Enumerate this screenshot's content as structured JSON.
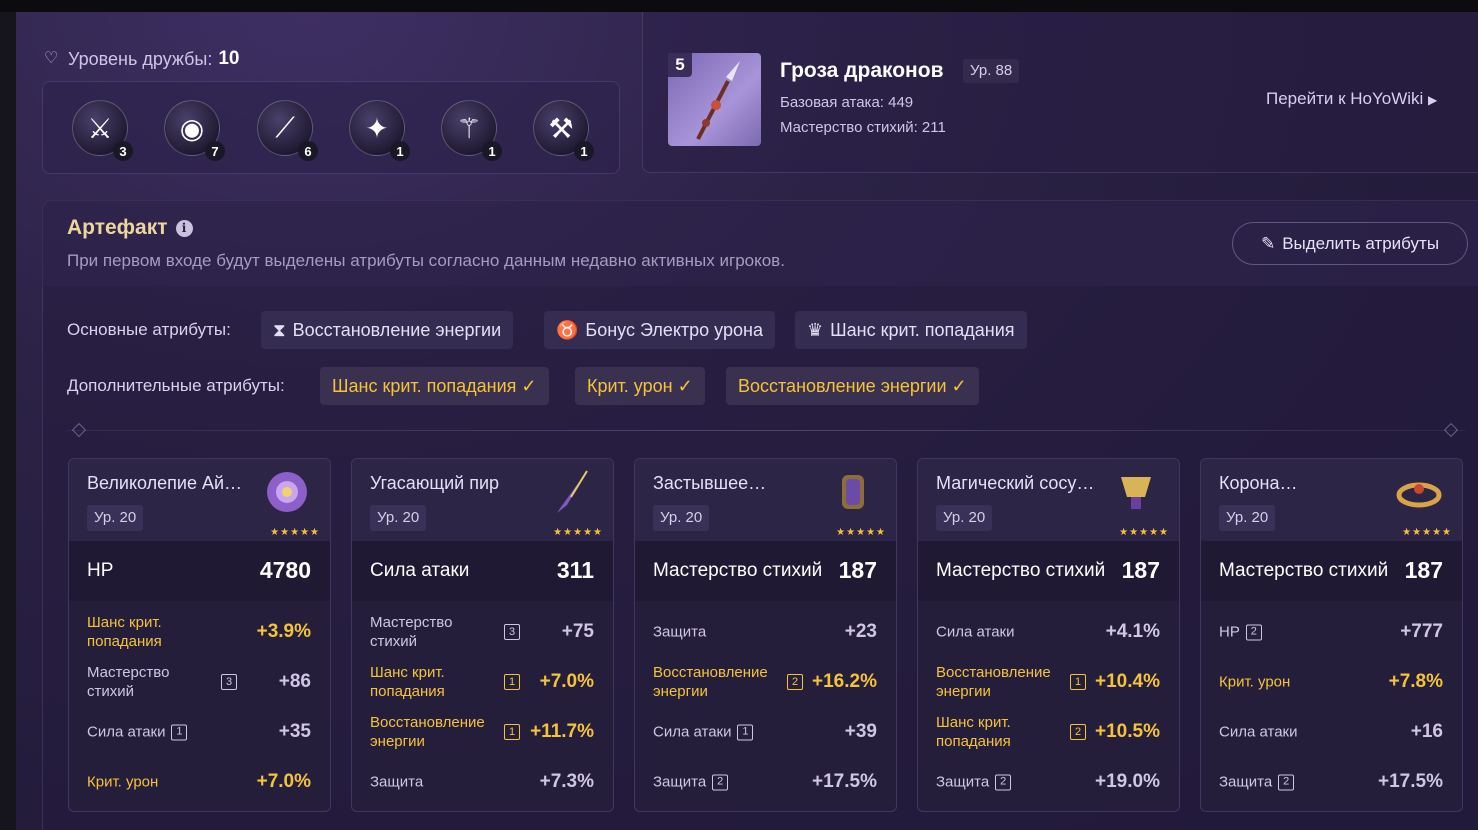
{
  "friendship": {
    "label": "Уровень дружбы:",
    "value": "10"
  },
  "constellations": [
    {
      "icon": "crossed-swords-icon",
      "count": "3"
    },
    {
      "icon": "eye-icon",
      "count": "7"
    },
    {
      "icon": "slash-icon",
      "count": "6"
    },
    {
      "icon": "sparkles-icon",
      "count": "1"
    },
    {
      "icon": "blade-icon",
      "count": "1"
    },
    {
      "icon": "triple-blade-icon",
      "count": "1"
    }
  ],
  "weapon": {
    "rank": "5",
    "name": "Гроза драконов",
    "level": "Ур. 88",
    "base_atk": "Базовая атака: 449",
    "substat": "Мастерство стихий: 211",
    "wiki_link": "Перейти к HoYoWiki"
  },
  "artifact": {
    "title": "Артефакт",
    "subtitle": "При первом входе будут выделены атрибуты согласно данным недавно активных игроков.",
    "highlight_button": "Выделить атрибуты",
    "main_label": "Основные атрибуты:",
    "main_attrs": [
      {
        "icon": "hourglass-icon",
        "label": "Восстановление энергии"
      },
      {
        "icon": "goblet-icon",
        "label": "Бонус Электро урона"
      },
      {
        "icon": "crown-icon",
        "label": "Шанс крит. попадания"
      }
    ],
    "sub_label": "Дополнительные атрибуты:",
    "sub_attrs": [
      {
        "label": "Шанс крит. попадания ✓"
      },
      {
        "label": "Крит. урон ✓"
      },
      {
        "label": "Восстановление энергии ✓"
      }
    ],
    "stars": "★★★★★",
    "cards": [
      {
        "name": "Великолепие Ай…",
        "level": "Ур. 20",
        "main": "HP",
        "main_val": "4780",
        "subs": [
          {
            "name": "Шанс крит. попадания",
            "roll": "",
            "val": "+3.9%",
            "hl": true
          },
          {
            "name": "Мастерство стихий",
            "roll": "3",
            "val": "+86",
            "hl": false
          },
          {
            "name": "Сила атаки",
            "roll": "1",
            "val": "+35",
            "hl": false
          },
          {
            "name": "Крит. урон",
            "roll": "",
            "val": "+7.0%",
            "hl": true
          }
        ]
      },
      {
        "name": "Угасающий пир",
        "level": "Ур. 20",
        "main": "Сила атаки",
        "main_val": "311",
        "subs": [
          {
            "name": "Мастерство стихий",
            "roll": "3",
            "val": "+75",
            "hl": false
          },
          {
            "name": "Шанс крит. попадания",
            "roll": "1",
            "val": "+7.0%",
            "hl": true
          },
          {
            "name": "Восстановление энергии",
            "roll": "1",
            "val": "+11.7%",
            "hl": true
          },
          {
            "name": "Защита",
            "roll": "",
            "val": "+7.3%",
            "hl": false
          }
        ]
      },
      {
        "name": "Застывшее…",
        "level": "Ур. 20",
        "main": "Мастерство стихий",
        "main_val": "187",
        "subs": [
          {
            "name": "Защита",
            "roll": "",
            "val": "+23",
            "hl": false
          },
          {
            "name": "Восстановление энергии",
            "roll": "2",
            "val": "+16.2%",
            "hl": true
          },
          {
            "name": "Сила атаки",
            "roll": "1",
            "val": "+39",
            "hl": false
          },
          {
            "name": "Защита",
            "roll": "2",
            "val": "+17.5%",
            "hl": false
          }
        ]
      },
      {
        "name": "Магический сосу…",
        "level": "Ур. 20",
        "main": "Мастерство стихий",
        "main_val": "187",
        "subs": [
          {
            "name": "Сила атаки",
            "roll": "",
            "val": "+4.1%",
            "hl": false
          },
          {
            "name": "Восстановление энергии",
            "roll": "1",
            "val": "+10.4%",
            "hl": true
          },
          {
            "name": "Шанс крит. попадания",
            "roll": "2",
            "val": "+10.5%",
            "hl": true
          },
          {
            "name": "Защита",
            "roll": "2",
            "val": "+19.0%",
            "hl": false
          }
        ]
      },
      {
        "name": "Корона…",
        "level": "Ур. 20",
        "main": "Мастерство стихий",
        "main_val": "187",
        "subs": [
          {
            "name": "HP",
            "roll": "2",
            "val": "+777",
            "hl": false
          },
          {
            "name": "Крит. урон",
            "roll": "",
            "val": "+7.8%",
            "hl": true
          },
          {
            "name": "Сила атаки",
            "roll": "",
            "val": "+16",
            "hl": false
          },
          {
            "name": "Защита",
            "roll": "2",
            "val": "+17.5%",
            "hl": false
          }
        ]
      }
    ]
  }
}
